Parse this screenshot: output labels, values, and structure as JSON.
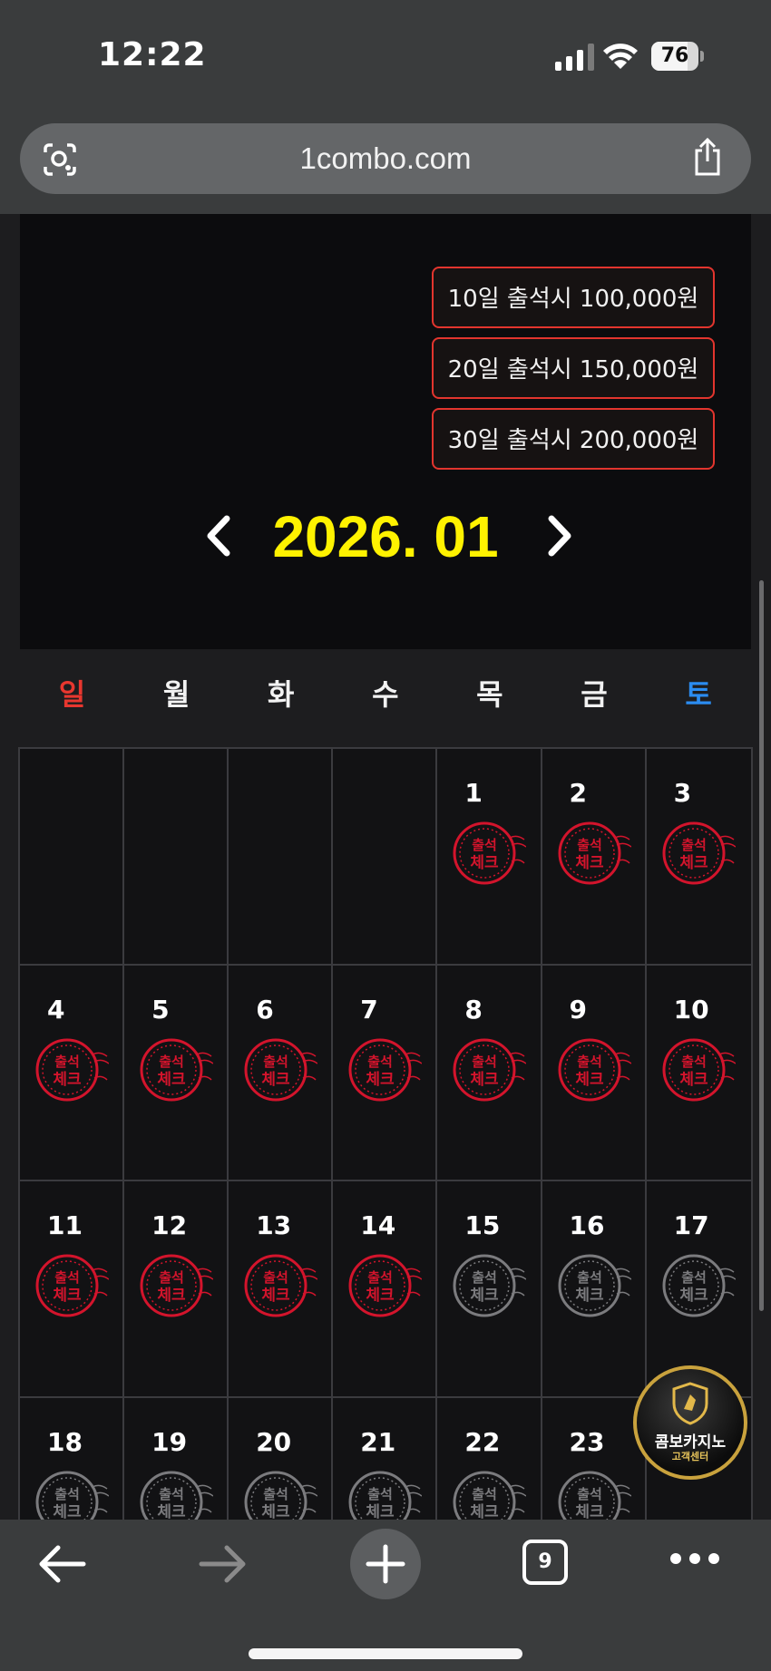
{
  "status_bar": {
    "time": "12:22",
    "battery": "76",
    "battery_level": 0.76
  },
  "browser": {
    "url": "1combo.com",
    "open_tabs": "9"
  },
  "rewards": [
    "10일 출석시 100,000원",
    "20일 출석시 150,000원",
    "30일 출석시 200,000원"
  ],
  "calendar": {
    "month_label": "2026. 01",
    "weekdays": [
      "일",
      "월",
      "화",
      "수",
      "목",
      "금",
      "토"
    ],
    "weekday_colors": {
      "sun": "#e8372f",
      "sat": "#2b8cf0",
      "default": "#f2f2f2"
    },
    "stamp_text": [
      "출석",
      "체크"
    ],
    "checked_color": "#d3142c",
    "unchecked_color": "#7b7b7e",
    "days": [
      {
        "day": "1",
        "checked": true
      },
      {
        "day": "2",
        "checked": true
      },
      {
        "day": "3",
        "checked": true
      },
      {
        "day": "4",
        "checked": true
      },
      {
        "day": "5",
        "checked": true
      },
      {
        "day": "6",
        "checked": true
      },
      {
        "day": "7",
        "checked": true
      },
      {
        "day": "8",
        "checked": true
      },
      {
        "day": "9",
        "checked": true
      },
      {
        "day": "10",
        "checked": true
      },
      {
        "day": "11",
        "checked": true
      },
      {
        "day": "12",
        "checked": true
      },
      {
        "day": "13",
        "checked": true
      },
      {
        "day": "14",
        "checked": true
      },
      {
        "day": "15",
        "checked": false
      },
      {
        "day": "16",
        "checked": false
      },
      {
        "day": "17",
        "checked": false
      },
      {
        "day": "18",
        "checked": false
      },
      {
        "day": "19",
        "checked": false
      },
      {
        "day": "20",
        "checked": false
      },
      {
        "day": "21",
        "checked": false
      },
      {
        "day": "22",
        "checked": false
      },
      {
        "day": "23",
        "checked": false
      }
    ],
    "first_weekday_index": 4
  },
  "support_button": {
    "label": "콤보카지노",
    "sub": "고객센터"
  },
  "icons": {
    "lens": "visual-search-icon",
    "share": "share-icon",
    "prev": "chevron-left-icon",
    "next": "chevron-right-icon",
    "back": "back-arrow-icon",
    "forward": "forward-arrow-icon",
    "new_tab": "plus-icon",
    "tabs": "tabs-icon",
    "more": "more-icon"
  }
}
